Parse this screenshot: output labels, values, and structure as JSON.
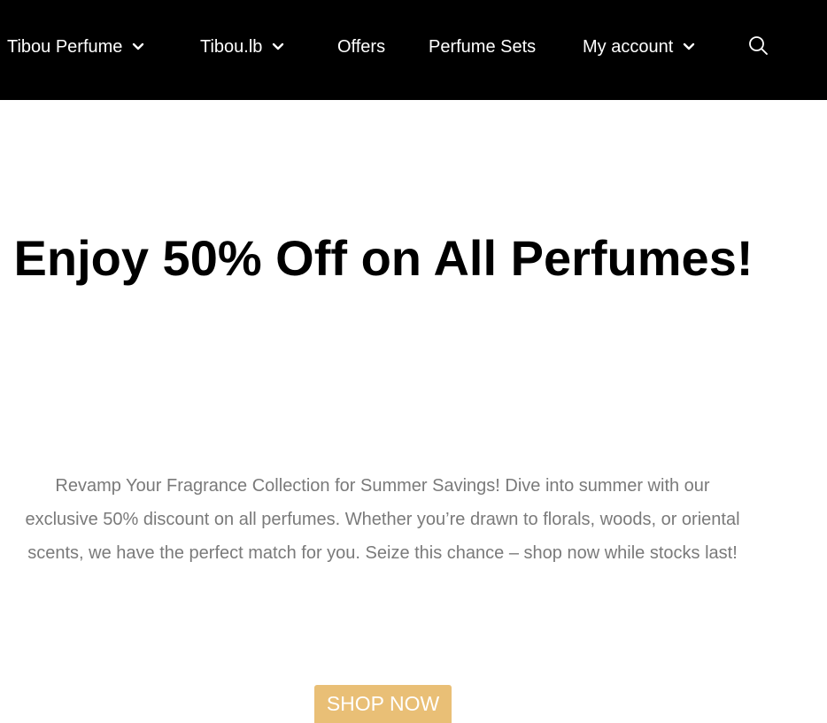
{
  "nav": {
    "items": [
      {
        "label": "Tibou Perfume",
        "has_dropdown": true
      },
      {
        "label": "Tibou.lb",
        "has_dropdown": true
      },
      {
        "label": "Offers",
        "has_dropdown": false
      },
      {
        "label": "Perfume Sets",
        "has_dropdown": false
      },
      {
        "label": "My account",
        "has_dropdown": true
      }
    ],
    "dropdown_icon": "chevron-down-icon",
    "search_icon": "search-icon",
    "background_color": "#000000",
    "text_color": "#ffffff"
  },
  "hero": {
    "title": "Enjoy 50% Off on All Perfumes!",
    "description": "Revamp Your Fragrance Collection for Summer Savings! Dive into summer with our exclusive 50% discount on all perfumes. Whether you’re drawn to florals, woods, or oriental scents, we have the perfect match for you. Seize this chance – shop now while stocks last!",
    "cta_label": "SHOP NOW",
    "cta_color": "#e9bf76",
    "text_color": "#7a7a7a"
  }
}
